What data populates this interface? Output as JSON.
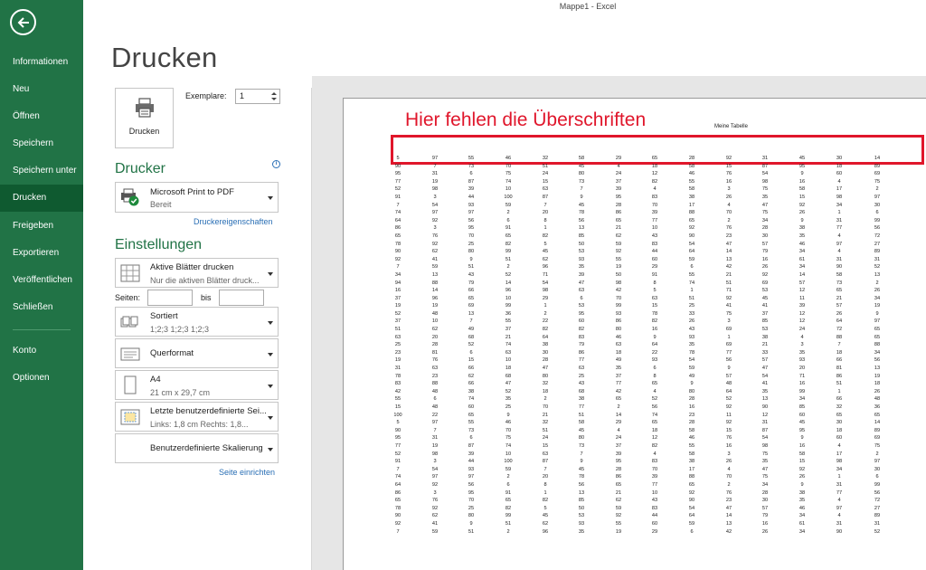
{
  "app": {
    "title": "Mappe1 - Excel"
  },
  "sidebar": {
    "items": [
      {
        "label": "Informationen",
        "active": false
      },
      {
        "label": "Neu",
        "active": false
      },
      {
        "label": "Öffnen",
        "active": false
      },
      {
        "label": "Speichern",
        "active": false
      },
      {
        "label": "Speichern unter",
        "active": false
      },
      {
        "label": "Drucken",
        "active": true
      },
      {
        "label": "Freigeben",
        "active": false
      },
      {
        "label": "Exportieren",
        "active": false
      },
      {
        "label": "Veröffentlichen",
        "active": false
      },
      {
        "label": "Schließen",
        "active": false
      },
      {
        "label": "Konto",
        "active": false
      },
      {
        "label": "Optionen",
        "active": false
      }
    ]
  },
  "print": {
    "heading": "Drucken",
    "button_label": "Drucken",
    "copies_label": "Exemplare:",
    "copies_value": "1"
  },
  "printer": {
    "section_title": "Drucker",
    "name": "Microsoft Print to PDF",
    "status": "Bereit",
    "properties_link": "Druckereigenschaften",
    "info_icon": "i"
  },
  "settings": {
    "section_title": "Einstellungen",
    "scope": {
      "title": "Aktive Blätter drucken",
      "subtitle": "Nur die aktiven Blätter druck..."
    },
    "pages_label": "Seiten:",
    "to_label": "bis",
    "collate": {
      "title": "Sortiert",
      "subtitle": "1;2;3    1;2;3    1;2;3"
    },
    "orientation": {
      "title": "Querformat"
    },
    "paper": {
      "title": "A4",
      "subtitle": "21  cm x 29,7  cm"
    },
    "margins": {
      "title": "Letzte benutzerdefinierte Sei...",
      "subtitle": "Links: 1,8  cm    Rechts: 1,8..."
    },
    "scaling": {
      "title": "Benutzerdefinierte Skalierung"
    },
    "page_setup_link": "Seite einrichten"
  },
  "preview": {
    "annotation": "Hier fehlen die Überschriften",
    "sheet_title": "Meine Tabelle",
    "first_row": [
      "5",
      "97",
      "55",
      "46",
      "32",
      "58",
      "29",
      "65",
      "28",
      "92",
      "31",
      "45",
      "30",
      "14"
    ],
    "rows": [
      [
        "90",
        "7",
        "73",
        "70",
        "51",
        "45",
        "4",
        "18",
        "58",
        "15",
        "87",
        "95",
        "18",
        "89"
      ],
      [
        "95",
        "31",
        "6",
        "75",
        "24",
        "80",
        "24",
        "12",
        "46",
        "76",
        "54",
        "9",
        "60",
        "69"
      ],
      [
        "77",
        "19",
        "87",
        "74",
        "15",
        "73",
        "37",
        "82",
        "55",
        "16",
        "98",
        "16",
        "4",
        "75"
      ],
      [
        "52",
        "98",
        "39",
        "10",
        "63",
        "7",
        "39",
        "4",
        "58",
        "3",
        "75",
        "58",
        "17",
        "2"
      ],
      [
        "91",
        "3",
        "44",
        "100",
        "87",
        "9",
        "95",
        "83",
        "38",
        "26",
        "35",
        "15",
        "98",
        "97"
      ],
      [
        "7",
        "54",
        "93",
        "59",
        "7",
        "45",
        "28",
        "70",
        "17",
        "4",
        "47",
        "92",
        "34",
        "30"
      ],
      [
        "74",
        "97",
        "97",
        "2",
        "20",
        "78",
        "86",
        "39",
        "88",
        "70",
        "75",
        "26",
        "1",
        "6"
      ],
      [
        "64",
        "92",
        "56",
        "6",
        "8",
        "56",
        "65",
        "77",
        "65",
        "2",
        "34",
        "9",
        "31",
        "99"
      ],
      [
        "86",
        "3",
        "95",
        "91",
        "1",
        "13",
        "21",
        "10",
        "92",
        "76",
        "28",
        "38",
        "77",
        "56"
      ],
      [
        "65",
        "76",
        "70",
        "65",
        "82",
        "85",
        "62",
        "43",
        "90",
        "23",
        "30",
        "35",
        "4",
        "72"
      ],
      [
        "78",
        "92",
        "25",
        "82",
        "5",
        "50",
        "59",
        "83",
        "54",
        "47",
        "57",
        "46",
        "97",
        "27"
      ],
      [
        "90",
        "62",
        "80",
        "99",
        "45",
        "53",
        "92",
        "44",
        "64",
        "14",
        "79",
        "34",
        "4",
        "89"
      ],
      [
        "92",
        "41",
        "9",
        "51",
        "62",
        "93",
        "55",
        "60",
        "59",
        "13",
        "16",
        "61",
        "31",
        "31"
      ],
      [
        "7",
        "59",
        "51",
        "2",
        "96",
        "35",
        "19",
        "29",
        "6",
        "42",
        "26",
        "34",
        "90",
        "52"
      ],
      [
        "34",
        "13",
        "43",
        "52",
        "71",
        "39",
        "50",
        "91",
        "55",
        "21",
        "92",
        "14",
        "58",
        "13"
      ],
      [
        "94",
        "88",
        "79",
        "14",
        "54",
        "47",
        "98",
        "8",
        "74",
        "51",
        "69",
        "57",
        "73",
        "2"
      ],
      [
        "16",
        "14",
        "66",
        "96",
        "98",
        "63",
        "42",
        "5",
        "1",
        "71",
        "53",
        "12",
        "65",
        "26"
      ],
      [
        "37",
        "96",
        "65",
        "10",
        "29",
        "6",
        "70",
        "63",
        "51",
        "92",
        "45",
        "11",
        "21",
        "34"
      ],
      [
        "19",
        "19",
        "69",
        "99",
        "1",
        "53",
        "99",
        "15",
        "25",
        "41",
        "41",
        "39",
        "57",
        "19"
      ],
      [
        "52",
        "48",
        "13",
        "36",
        "2",
        "95",
        "93",
        "78",
        "33",
        "75",
        "37",
        "12",
        "26",
        "9"
      ],
      [
        "37",
        "10",
        "7",
        "55",
        "22",
        "60",
        "86",
        "82",
        "26",
        "3",
        "85",
        "12",
        "64",
        "97"
      ],
      [
        "51",
        "62",
        "49",
        "37",
        "82",
        "82",
        "80",
        "16",
        "43",
        "69",
        "53",
        "24",
        "72",
        "65"
      ],
      [
        "63",
        "20",
        "68",
        "21",
        "64",
        "83",
        "46",
        "9",
        "93",
        "1",
        "38",
        "4",
        "88",
        "65"
      ],
      [
        "25",
        "28",
        "52",
        "74",
        "38",
        "79",
        "63",
        "64",
        "35",
        "69",
        "21",
        "3",
        "7",
        "88"
      ],
      [
        "23",
        "81",
        "6",
        "63",
        "30",
        "86",
        "18",
        "22",
        "78",
        "77",
        "33",
        "35",
        "18",
        "34"
      ],
      [
        "19",
        "76",
        "15",
        "10",
        "28",
        "77",
        "49",
        "93",
        "54",
        "56",
        "57",
        "93",
        "66",
        "56"
      ],
      [
        "31",
        "63",
        "66",
        "18",
        "47",
        "63",
        "35",
        "6",
        "59",
        "9",
        "47",
        "20",
        "81",
        "13"
      ],
      [
        "78",
        "23",
        "62",
        "68",
        "80",
        "25",
        "37",
        "8",
        "49",
        "57",
        "54",
        "71",
        "86",
        "19"
      ],
      [
        "83",
        "88",
        "66",
        "47",
        "32",
        "43",
        "77",
        "65",
        "9",
        "48",
        "41",
        "16",
        "51",
        "18"
      ],
      [
        "42",
        "48",
        "38",
        "52",
        "18",
        "68",
        "42",
        "4",
        "80",
        "64",
        "35",
        "99",
        "1",
        "26"
      ],
      [
        "55",
        "6",
        "74",
        "35",
        "2",
        "38",
        "65",
        "52",
        "28",
        "52",
        "13",
        "34",
        "66",
        "48"
      ],
      [
        "15",
        "48",
        "60",
        "25",
        "70",
        "77",
        "2",
        "56",
        "16",
        "92",
        "90",
        "85",
        "32",
        "36"
      ],
      [
        "100",
        "22",
        "65",
        "9",
        "21",
        "51",
        "14",
        "74",
        "23",
        "11",
        "12",
        "60",
        "65",
        "65"
      ],
      [
        "5",
        "97",
        "55",
        "46",
        "32",
        "58",
        "29",
        "65",
        "28",
        "92",
        "31",
        "45",
        "30",
        "14"
      ],
      [
        "90",
        "7",
        "73",
        "70",
        "51",
        "45",
        "4",
        "18",
        "58",
        "15",
        "87",
        "95",
        "18",
        "89"
      ],
      [
        "95",
        "31",
        "6",
        "75",
        "24",
        "80",
        "24",
        "12",
        "46",
        "76",
        "54",
        "9",
        "60",
        "69"
      ],
      [
        "77",
        "19",
        "87",
        "74",
        "15",
        "73",
        "37",
        "82",
        "55",
        "16",
        "98",
        "16",
        "4",
        "75"
      ],
      [
        "52",
        "98",
        "39",
        "10",
        "63",
        "7",
        "39",
        "4",
        "58",
        "3",
        "75",
        "58",
        "17",
        "2"
      ],
      [
        "91",
        "3",
        "44",
        "100",
        "87",
        "9",
        "95",
        "83",
        "38",
        "26",
        "35",
        "15",
        "98",
        "97"
      ],
      [
        "7",
        "54",
        "93",
        "59",
        "7",
        "45",
        "28",
        "70",
        "17",
        "4",
        "47",
        "92",
        "34",
        "30"
      ],
      [
        "74",
        "97",
        "97",
        "2",
        "20",
        "78",
        "86",
        "39",
        "88",
        "70",
        "75",
        "26",
        "1",
        "6"
      ],
      [
        "64",
        "92",
        "56",
        "6",
        "8",
        "56",
        "65",
        "77",
        "65",
        "2",
        "34",
        "9",
        "31",
        "99"
      ],
      [
        "86",
        "3",
        "95",
        "91",
        "1",
        "13",
        "21",
        "10",
        "92",
        "76",
        "28",
        "38",
        "77",
        "56"
      ],
      [
        "65",
        "76",
        "70",
        "65",
        "82",
        "85",
        "62",
        "43",
        "90",
        "23",
        "30",
        "35",
        "4",
        "72"
      ],
      [
        "78",
        "92",
        "25",
        "82",
        "5",
        "50",
        "59",
        "83",
        "54",
        "47",
        "57",
        "46",
        "97",
        "27"
      ],
      [
        "90",
        "62",
        "80",
        "99",
        "45",
        "53",
        "92",
        "44",
        "64",
        "14",
        "79",
        "34",
        "4",
        "89"
      ],
      [
        "92",
        "41",
        "9",
        "51",
        "62",
        "93",
        "55",
        "60",
        "59",
        "13",
        "16",
        "61",
        "31",
        "31"
      ],
      [
        "7",
        "59",
        "51",
        "2",
        "96",
        "35",
        "19",
        "29",
        "6",
        "42",
        "26",
        "34",
        "90",
        "52"
      ]
    ]
  },
  "colors": {
    "accent": "#217346",
    "accent_dark": "#0f5a30",
    "annotation": "#e0162b",
    "link": "#2a6fb5"
  }
}
